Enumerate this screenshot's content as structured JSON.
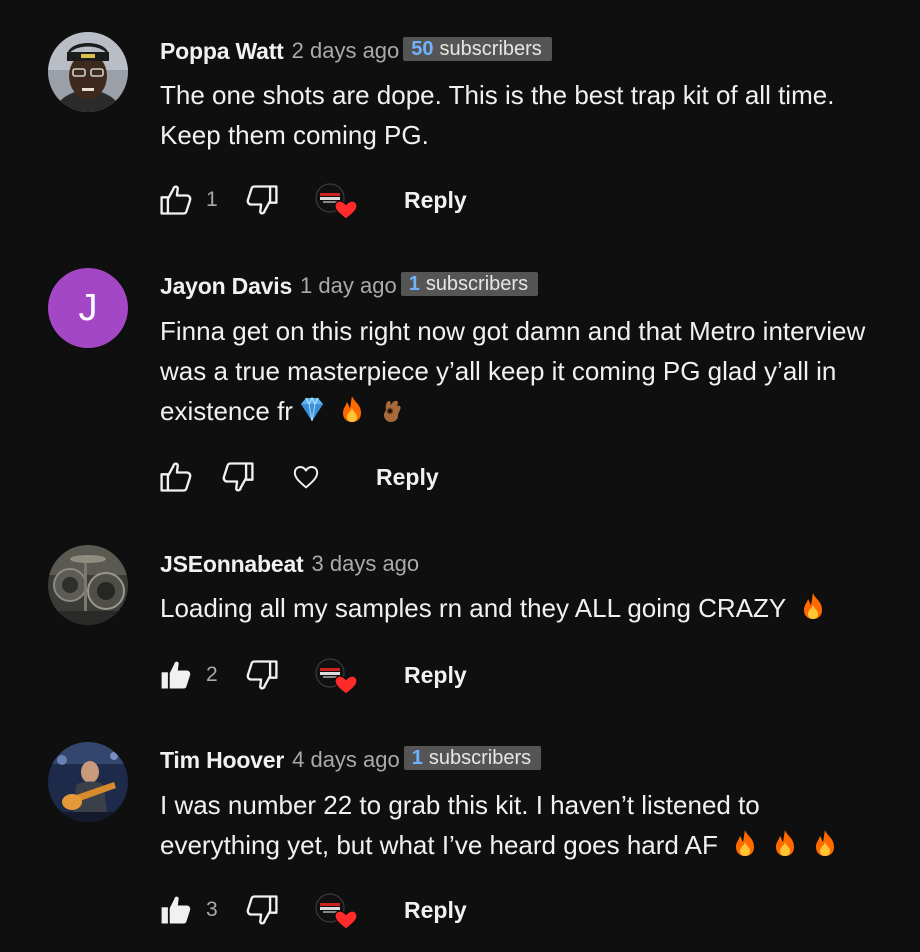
{
  "comments": [
    {
      "author": "Poppa Watt",
      "time": "2 days ago",
      "badge_count": "50",
      "badge_label": "subscribers",
      "text": "The one shots are dope. This is the best trap kit of all time. Keep them coming PG.",
      "likes": "1",
      "liked": false,
      "creator_hearted": true,
      "reply_label": "Reply"
    },
    {
      "author": "Jayon Davis",
      "time": "1 day ago",
      "badge_count": "1",
      "badge_label": "subscribers",
      "avatar_letter": "J",
      "text": "Finna get on this right now got damn and that Metro interview was a true masterpiece y’all keep it coming PG glad y’all in existence fr",
      "likes": "",
      "liked": false,
      "creator_hearted": false,
      "reply_label": "Reply"
    },
    {
      "author": "JSEonnabeat",
      "time": "3 days ago",
      "text": "Loading all my samples rn and they ALL going CRAZY",
      "likes": "2",
      "liked": true,
      "creator_hearted": true,
      "reply_label": "Reply"
    },
    {
      "author": "Tim Hoover",
      "time": "4 days ago",
      "badge_count": "1",
      "badge_label": "subscribers",
      "text": "I was number 22 to grab this kit. I haven’t listened to everything yet, but what I’ve heard goes hard AF",
      "likes": "3",
      "liked": true,
      "creator_hearted": true,
      "reply_label": "Reply"
    }
  ],
  "colors": {
    "background": "#0f0f0f",
    "badge_bg": "#555555",
    "badge_number": "#6fb3ff",
    "heart": "#ff2b2b",
    "avatar_purple": "#a347c4"
  },
  "icons": {
    "like": "thumbs-up-icon",
    "dislike": "thumbs-down-icon",
    "heart": "heart-icon",
    "creator_heart": "creator-heart-icon",
    "emojis": [
      "gem-emoji",
      "fire-emoji",
      "ok-hand-emoji"
    ]
  }
}
